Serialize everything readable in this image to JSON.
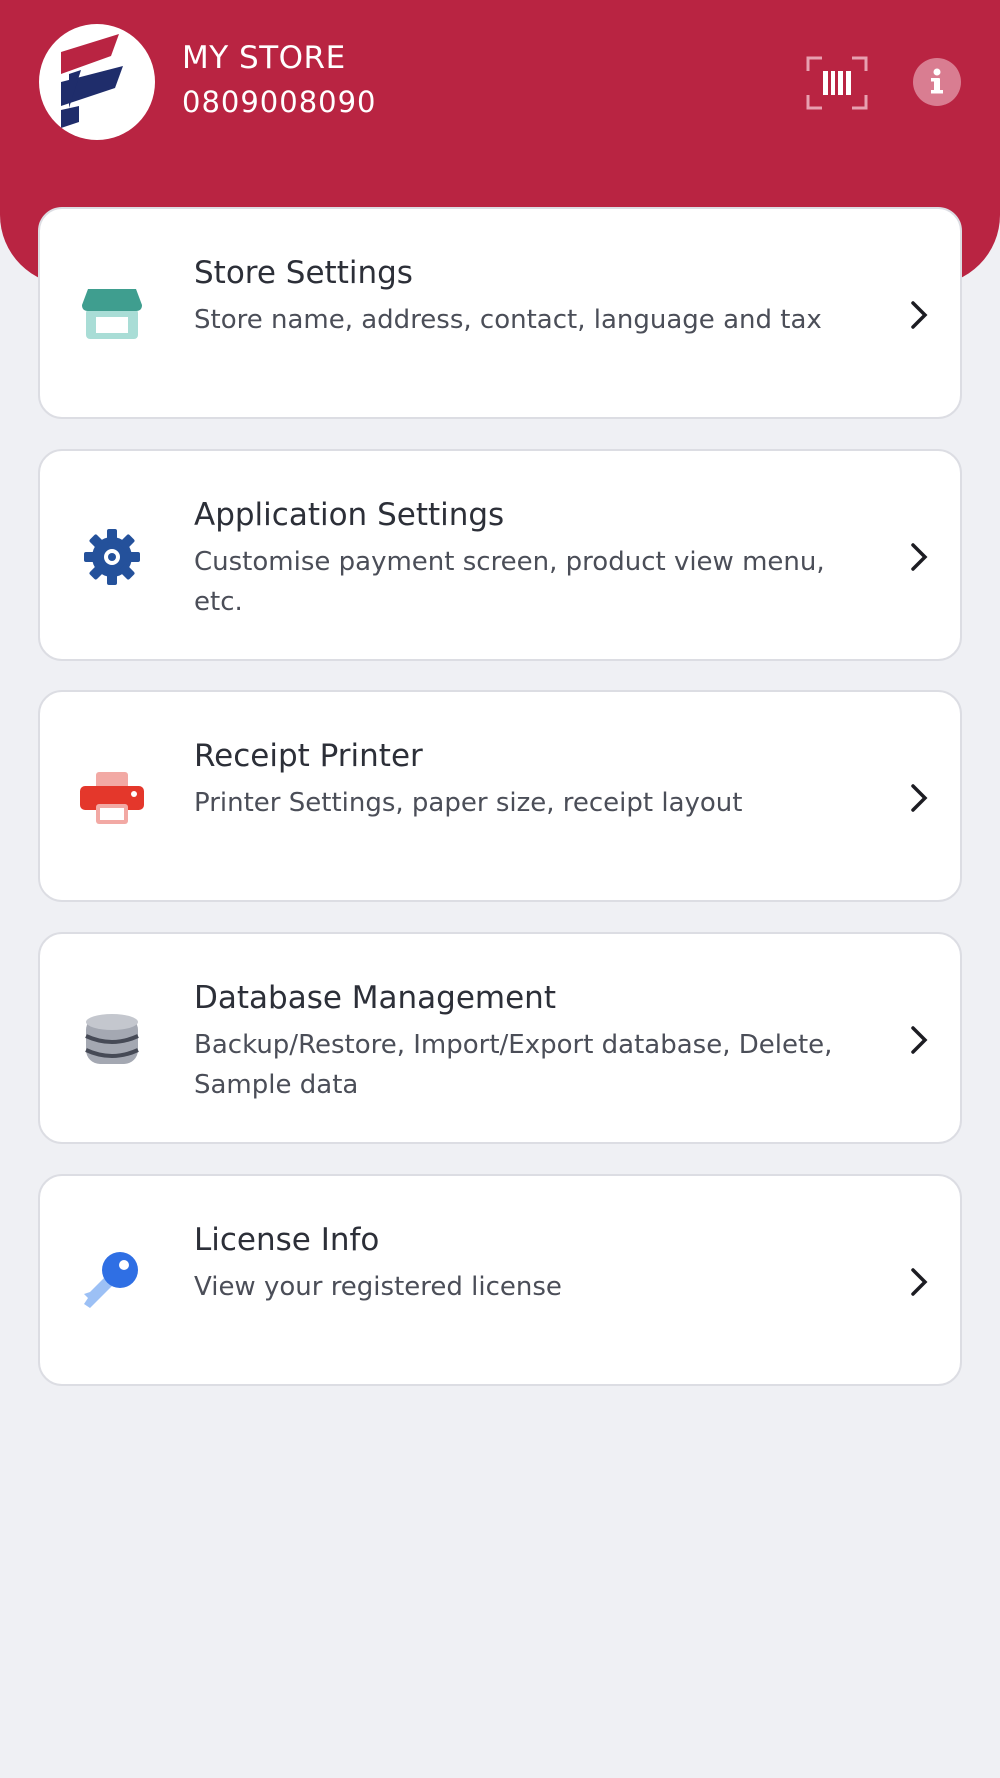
{
  "header": {
    "store_name": "MY STORE",
    "store_phone": "0809008090",
    "brand_color": "#b92442"
  },
  "menu": [
    {
      "title": "Store Settings",
      "subtitle": "Store name, address, contact, language and tax",
      "icon": "store-icon"
    },
    {
      "title": "Application Settings",
      "subtitle": "Customise payment screen, product view menu, etc.",
      "icon": "gear-icon"
    },
    {
      "title": "Receipt Printer",
      "subtitle": "Printer Settings, paper size, receipt layout",
      "icon": "printer-icon"
    },
    {
      "title": "Database Management",
      "subtitle": "Backup/Restore, Import/Export database, Delete, Sample data",
      "icon": "database-icon"
    },
    {
      "title": "License Info",
      "subtitle": "View your registered license",
      "icon": "key-icon"
    }
  ]
}
